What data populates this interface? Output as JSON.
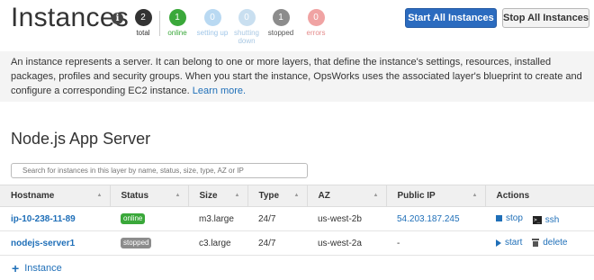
{
  "header": {
    "title": "Instances",
    "stats": [
      {
        "count": "2",
        "label": "total",
        "color": "#333333",
        "label_color": "#333333"
      },
      {
        "count": "1",
        "label": "online",
        "color": "#3aa83a",
        "label_color": "#3aa83a"
      },
      {
        "count": "0",
        "label": "setting up",
        "color": "#b9d9f2",
        "label_color": "#9fc6e8"
      },
      {
        "count": "0",
        "label": "shutting down",
        "color": "#c9dff0",
        "label_color": "#a9c8e3"
      },
      {
        "count": "1",
        "label": "stopped",
        "color": "#8c8c8c",
        "label_color": "#555555"
      },
      {
        "count": "0",
        "label": "errors",
        "color": "#f0a3a3",
        "label_color": "#e48a8a"
      }
    ],
    "start_all_label": "Start All Instances",
    "stop_all_label": "Stop All Instances"
  },
  "description": {
    "text": "An instance represents a server. It can belong to one or more layers, that define the instance's settings, resources, installed packages, profiles and security groups. When you start the instance, OpsWorks uses the associated layer's blueprint to create and configure a corresponding EC2 instance.",
    "link": "Learn more."
  },
  "layer": {
    "title": "Node.js App Server",
    "search_placeholder": "Search for instances in this layer by name, status, size, type, AZ or IP"
  },
  "table": {
    "columns": [
      "Hostname",
      "Status",
      "Size",
      "Type",
      "AZ",
      "Public IP",
      "Actions"
    ],
    "rows": [
      {
        "hostname": "ip-10-238-11-89",
        "status": "online",
        "status_color": "#3aa83a",
        "size": "m3.large",
        "type": "24/7",
        "az": "us-west-2b",
        "public_ip": "54.203.187.245",
        "action1": "stop",
        "action1_icon": "stop-icon",
        "action2": "ssh",
        "action2_icon": "terminal-icon"
      },
      {
        "hostname": "nodejs-server1",
        "status": "stopped",
        "status_color": "#8c8c8c",
        "size": "c3.large",
        "type": "24/7",
        "az": "us-west-2a",
        "public_ip": "-",
        "action1": "start",
        "action1_icon": "play-icon",
        "action2": "delete",
        "action2_icon": "trash-icon"
      }
    ]
  },
  "add_instance_label": "Instance",
  "colors": {
    "accent": "#2b6bbf",
    "link": "#1f6fb8"
  }
}
